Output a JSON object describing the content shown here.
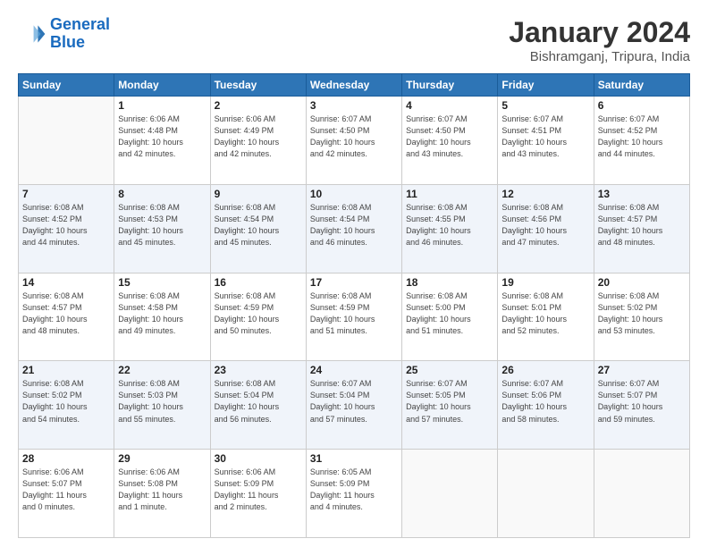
{
  "header": {
    "logo_line1": "General",
    "logo_line2": "Blue",
    "month": "January 2024",
    "location": "Bishramganj, Tripura, India"
  },
  "weekdays": [
    "Sunday",
    "Monday",
    "Tuesday",
    "Wednesday",
    "Thursday",
    "Friday",
    "Saturday"
  ],
  "weeks": [
    [
      {
        "num": "",
        "info": ""
      },
      {
        "num": "1",
        "info": "Sunrise: 6:06 AM\nSunset: 4:48 PM\nDaylight: 10 hours\nand 42 minutes."
      },
      {
        "num": "2",
        "info": "Sunrise: 6:06 AM\nSunset: 4:49 PM\nDaylight: 10 hours\nand 42 minutes."
      },
      {
        "num": "3",
        "info": "Sunrise: 6:07 AM\nSunset: 4:50 PM\nDaylight: 10 hours\nand 42 minutes."
      },
      {
        "num": "4",
        "info": "Sunrise: 6:07 AM\nSunset: 4:50 PM\nDaylight: 10 hours\nand 43 minutes."
      },
      {
        "num": "5",
        "info": "Sunrise: 6:07 AM\nSunset: 4:51 PM\nDaylight: 10 hours\nand 43 minutes."
      },
      {
        "num": "6",
        "info": "Sunrise: 6:07 AM\nSunset: 4:52 PM\nDaylight: 10 hours\nand 44 minutes."
      }
    ],
    [
      {
        "num": "7",
        "info": "Sunrise: 6:08 AM\nSunset: 4:52 PM\nDaylight: 10 hours\nand 44 minutes."
      },
      {
        "num": "8",
        "info": "Sunrise: 6:08 AM\nSunset: 4:53 PM\nDaylight: 10 hours\nand 45 minutes."
      },
      {
        "num": "9",
        "info": "Sunrise: 6:08 AM\nSunset: 4:54 PM\nDaylight: 10 hours\nand 45 minutes."
      },
      {
        "num": "10",
        "info": "Sunrise: 6:08 AM\nSunset: 4:54 PM\nDaylight: 10 hours\nand 46 minutes."
      },
      {
        "num": "11",
        "info": "Sunrise: 6:08 AM\nSunset: 4:55 PM\nDaylight: 10 hours\nand 46 minutes."
      },
      {
        "num": "12",
        "info": "Sunrise: 6:08 AM\nSunset: 4:56 PM\nDaylight: 10 hours\nand 47 minutes."
      },
      {
        "num": "13",
        "info": "Sunrise: 6:08 AM\nSunset: 4:57 PM\nDaylight: 10 hours\nand 48 minutes."
      }
    ],
    [
      {
        "num": "14",
        "info": "Sunrise: 6:08 AM\nSunset: 4:57 PM\nDaylight: 10 hours\nand 48 minutes."
      },
      {
        "num": "15",
        "info": "Sunrise: 6:08 AM\nSunset: 4:58 PM\nDaylight: 10 hours\nand 49 minutes."
      },
      {
        "num": "16",
        "info": "Sunrise: 6:08 AM\nSunset: 4:59 PM\nDaylight: 10 hours\nand 50 minutes."
      },
      {
        "num": "17",
        "info": "Sunrise: 6:08 AM\nSunset: 4:59 PM\nDaylight: 10 hours\nand 51 minutes."
      },
      {
        "num": "18",
        "info": "Sunrise: 6:08 AM\nSunset: 5:00 PM\nDaylight: 10 hours\nand 51 minutes."
      },
      {
        "num": "19",
        "info": "Sunrise: 6:08 AM\nSunset: 5:01 PM\nDaylight: 10 hours\nand 52 minutes."
      },
      {
        "num": "20",
        "info": "Sunrise: 6:08 AM\nSunset: 5:02 PM\nDaylight: 10 hours\nand 53 minutes."
      }
    ],
    [
      {
        "num": "21",
        "info": "Sunrise: 6:08 AM\nSunset: 5:02 PM\nDaylight: 10 hours\nand 54 minutes."
      },
      {
        "num": "22",
        "info": "Sunrise: 6:08 AM\nSunset: 5:03 PM\nDaylight: 10 hours\nand 55 minutes."
      },
      {
        "num": "23",
        "info": "Sunrise: 6:08 AM\nSunset: 5:04 PM\nDaylight: 10 hours\nand 56 minutes."
      },
      {
        "num": "24",
        "info": "Sunrise: 6:07 AM\nSunset: 5:04 PM\nDaylight: 10 hours\nand 57 minutes."
      },
      {
        "num": "25",
        "info": "Sunrise: 6:07 AM\nSunset: 5:05 PM\nDaylight: 10 hours\nand 57 minutes."
      },
      {
        "num": "26",
        "info": "Sunrise: 6:07 AM\nSunset: 5:06 PM\nDaylight: 10 hours\nand 58 minutes."
      },
      {
        "num": "27",
        "info": "Sunrise: 6:07 AM\nSunset: 5:07 PM\nDaylight: 10 hours\nand 59 minutes."
      }
    ],
    [
      {
        "num": "28",
        "info": "Sunrise: 6:06 AM\nSunset: 5:07 PM\nDaylight: 11 hours\nand 0 minutes."
      },
      {
        "num": "29",
        "info": "Sunrise: 6:06 AM\nSunset: 5:08 PM\nDaylight: 11 hours\nand 1 minute."
      },
      {
        "num": "30",
        "info": "Sunrise: 6:06 AM\nSunset: 5:09 PM\nDaylight: 11 hours\nand 2 minutes."
      },
      {
        "num": "31",
        "info": "Sunrise: 6:05 AM\nSunset: 5:09 PM\nDaylight: 11 hours\nand 4 minutes."
      },
      {
        "num": "",
        "info": ""
      },
      {
        "num": "",
        "info": ""
      },
      {
        "num": "",
        "info": ""
      }
    ]
  ]
}
